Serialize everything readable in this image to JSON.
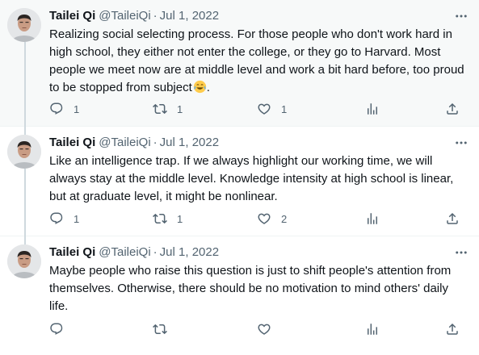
{
  "tweets": [
    {
      "author": "Tailei Qi",
      "handle": "@TaileiQi",
      "separator": "·",
      "date": "Jul 1, 2022",
      "text": "Realizing social selecting process. For those people who don't work hard in high school, they either not enter the college, or they go to Harvard. Most people we meet now are at middle level and work a bit hard before, too proud to be stopped from subject",
      "text_suffix": ".",
      "emoji": "face-with-tears-of-joy",
      "replies": "1",
      "retweets": "1",
      "likes": "1",
      "views": ""
    },
    {
      "author": "Tailei Qi",
      "handle": "@TaileiQi",
      "separator": "·",
      "date": "Jul 1, 2022",
      "text": "Like an intelligence trap. If we always highlight our working time, we will always stay at the middle level. Knowledge intensity at high school is linear, but at graduate level, it might be nonlinear.",
      "replies": "1",
      "retweets": "1",
      "likes": "2",
      "views": ""
    },
    {
      "author": "Tailei Qi",
      "handle": "@TaileiQi",
      "separator": "·",
      "date": "Jul 1, 2022",
      "text": "Maybe people who raise this question is just to shift people's attention from themselves.  Otherwise, there should be no motivation to mind others' daily life.",
      "replies": "",
      "retweets": "",
      "likes": "",
      "views": ""
    }
  ],
  "colors": {
    "text": "#0f1419",
    "muted": "#536471",
    "thread_line": "#cfd9de",
    "highlight_bg": "#f7f9f9"
  }
}
